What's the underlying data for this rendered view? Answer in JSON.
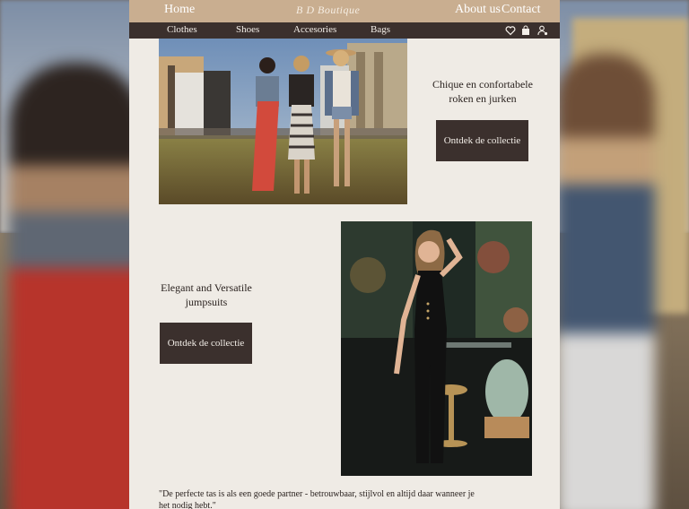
{
  "header": {
    "home_label": "Home",
    "brand": "B D Boutique",
    "about_label": "About us",
    "contact_label": "Contact"
  },
  "nav": {
    "items": [
      "Clothes",
      "Shoes",
      "Accesories",
      "Bags"
    ],
    "icons": [
      "heart-icon",
      "shopping-bag-icon",
      "user-settings-icon"
    ]
  },
  "sections": [
    {
      "title": "Chique en confortabele roken en jurken",
      "cta_label": "Ontdek de collectie"
    },
    {
      "title": "Elegant and Versatile jumpsuits",
      "cta_label": "Ontdek de collectie"
    }
  ],
  "quote": "\"De perfecte tas is als een goede partner - betrouwbaar, stijlvol en altijd daar wanneer je het nodig hebt.\"",
  "colors": {
    "header_bg": "#c9ae90",
    "nav_bg": "#3b302d",
    "page_bg": "#efebe5",
    "button_bg": "#3b302d"
  }
}
